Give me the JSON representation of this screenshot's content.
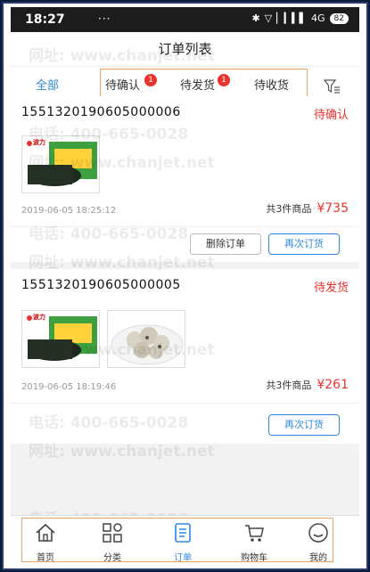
{
  "status_bar": {
    "time": "18:27",
    "dots": "···",
    "network": "4G",
    "battery": "82"
  },
  "header": {
    "title": "订单列表"
  },
  "tabs": [
    {
      "label": "全部"
    },
    {
      "label": "待确认",
      "badge": "1"
    },
    {
      "label": "待发货",
      "badge": "1"
    },
    {
      "label": "待收货"
    }
  ],
  "watermark": {
    "phone": "电话: 400-665-0028",
    "site": "网址: www.chanjet.net"
  },
  "orders": [
    {
      "order_no": "1551320190605000006",
      "status": "待确认",
      "date": "2019-06-05 18:25:12",
      "count": "共3件商品",
      "price": "¥735",
      "buttons": [
        "删除订单",
        "再次订货"
      ]
    },
    {
      "order_no": "1551320190605000005",
      "status": "待发货",
      "date": "2019-06-05 18:19:46",
      "count": "共3件商品",
      "price": "¥261",
      "buttons": [
        "再次订货"
      ]
    }
  ],
  "product_brand": "波力",
  "nav": [
    {
      "label": "首页"
    },
    {
      "label": "分类"
    },
    {
      "label": "订单"
    },
    {
      "label": "购物车"
    },
    {
      "label": "我的"
    }
  ],
  "colors": {
    "accent": "#2f86e0",
    "price": "#e8332a",
    "highlight_box": "#f0a060"
  }
}
